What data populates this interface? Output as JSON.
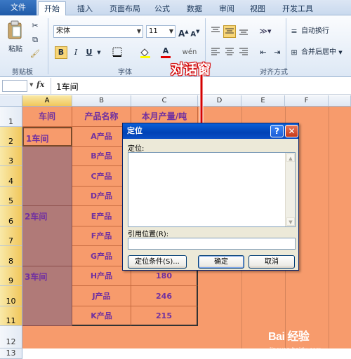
{
  "ribbon": {
    "tabs": [
      "文件",
      "开始",
      "插入",
      "页面布局",
      "公式",
      "数据",
      "审阅",
      "视图",
      "开发工具"
    ],
    "clipboard": {
      "paste": "粘贴",
      "group_label": "剪贴板"
    },
    "font": {
      "name": "宋体",
      "size": "11",
      "bold": "B",
      "italic": "I",
      "underline": "U",
      "group_label": "字体"
    },
    "align": {
      "wrap": "自动换行",
      "merge": "合并后居中",
      "group_label": "对齐方式"
    }
  },
  "formula_bar": {
    "fx": "fx",
    "content": "1车间"
  },
  "sheet": {
    "columns": [
      "A",
      "B",
      "C",
      "D",
      "E",
      "F"
    ],
    "rows": [
      "1",
      "2",
      "3",
      "4",
      "5",
      "6",
      "7",
      "8",
      "9",
      "10",
      "11",
      "12",
      "13"
    ],
    "headers": {
      "a": "车间",
      "b": "产品名称",
      "c": "本月产量/吨"
    },
    "workshops": [
      "1车间",
      "2车间",
      "3车间"
    ],
    "products": [
      "A产品",
      "B产品",
      "C产品",
      "D产品",
      "E产品",
      "F产品",
      "G产品",
      "H产品",
      "J产品",
      "K产品"
    ],
    "values": [
      "180",
      "246",
      "215"
    ]
  },
  "dialog": {
    "title": "定位",
    "help": "?",
    "close": "✕",
    "goto_label": "定位:",
    "ref_label": "引用位置(R):",
    "special_button": "定位条件(S)...",
    "ok_button": "确定",
    "cancel_button": "取消"
  },
  "annotation": "对话窗",
  "watermark": {
    "brand": "Bai 经验",
    "url": "jingyan.baidu.com"
  },
  "colors": {
    "fill": "#f79b6c",
    "merged": "#b07a78",
    "text": "#7030a0",
    "annotation": "#d40000"
  }
}
